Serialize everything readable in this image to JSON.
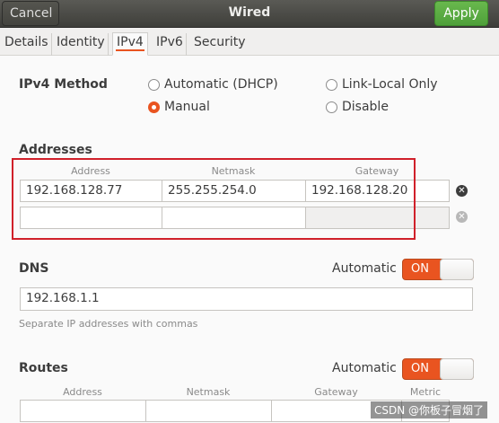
{
  "header": {
    "cancel_label": "Cancel",
    "title": "Wired",
    "apply_label": "Apply"
  },
  "tabs": [
    "Details",
    "Identity",
    "IPv4",
    "IPv6",
    "Security"
  ],
  "ipv4_method": {
    "label": "IPv4 Method",
    "options": [
      "Automatic (DHCP)",
      "Link-Local Only",
      "Manual",
      "Disable"
    ],
    "selected": "Manual"
  },
  "addresses": {
    "label": "Addresses",
    "columns": [
      "Address",
      "Netmask",
      "Gateway"
    ],
    "rows": [
      [
        "192.168.128.77",
        "255.255.254.0",
        "192.168.128.20"
      ],
      [
        "",
        "",
        ""
      ]
    ]
  },
  "dns": {
    "label": "DNS",
    "automatic_label": "Automatic",
    "toggle_label": "ON",
    "value": "192.168.1.1",
    "hint": "Separate IP addresses with commas"
  },
  "routes": {
    "label": "Routes",
    "automatic_label": "Automatic",
    "toggle_label": "ON",
    "columns": [
      "Address",
      "Netmask",
      "Gateway",
      "Metric"
    ]
  },
  "watermark": "CSDN @你板子冒烟了",
  "colors": {
    "accent": "#e95420",
    "apply_green": "#5aa842",
    "highlight_box": "#d0202a"
  }
}
